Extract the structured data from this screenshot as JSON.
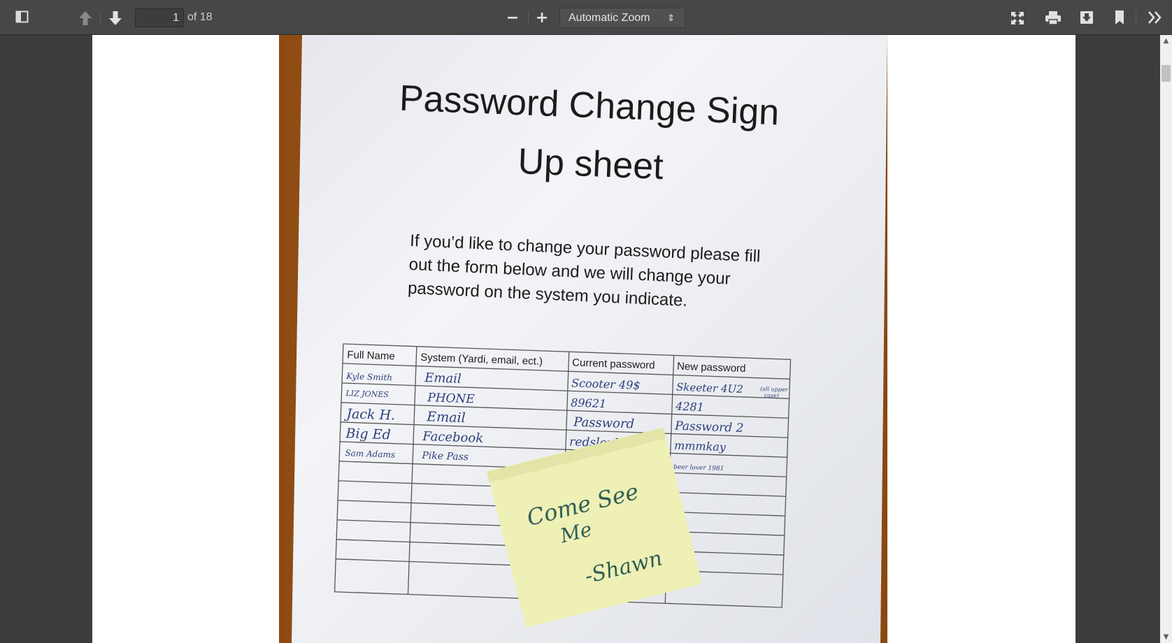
{
  "toolbar": {
    "sidebar_toggle_icon": "sidebar-toggle-icon",
    "prev_page_icon": "arrow-up-icon",
    "next_page_icon": "arrow-down-icon",
    "page_number": "1",
    "page_count_label": "of 18",
    "zoom_out_icon": "minus-icon",
    "zoom_in_icon": "plus-icon",
    "zoom_value": "Automatic Zoom",
    "presentation_icon": "presentation-mode-icon",
    "print_icon": "printer-icon",
    "download_icon": "download-icon",
    "bookmark_icon": "bookmark-icon",
    "tools_icon": "double-chevron-right-icon"
  },
  "document": {
    "title_line1": "Password Change Sign",
    "title_line2": "Up sheet",
    "instructions": [
      "If you’d like to change your password please fill",
      "out the form below and we will change your",
      "password on the system you indicate."
    ],
    "table_headers": [
      "Full Name",
      "System (Yardi, email, ect.)",
      "Current password",
      "New password"
    ],
    "rows": [
      [
        "Kyle Smith",
        "Email",
        "Scooter 49$",
        "Skeeter 4U2"
      ],
      [
        "LIZ JONES",
        "PHONE",
        "89621",
        "4281"
      ],
      [
        "Jack H.",
        "Email",
        "Password",
        "Password 2"
      ],
      [
        "Big Ed",
        "Facebook",
        "redsleple",
        "mmmkay"
      ],
      [
        "Sam Adams",
        "Pike Pass",
        "",
        "beer lover 1981"
      ]
    ],
    "side_note": [
      "(all upper",
      "case)"
    ],
    "sticky_note": [
      "Come See",
      "Me",
      "-Shawn"
    ]
  },
  "colors": {
    "toolbar_bg": "#474747",
    "viewer_bg": "#3c3c3c",
    "page_bg": "#ffffff",
    "wood": "#b0651f",
    "paper": "#eef0f4",
    "sticky_note": "#eef0b6",
    "ink_blue": "#2d3f7a",
    "ink_green": "#2f5e55"
  }
}
